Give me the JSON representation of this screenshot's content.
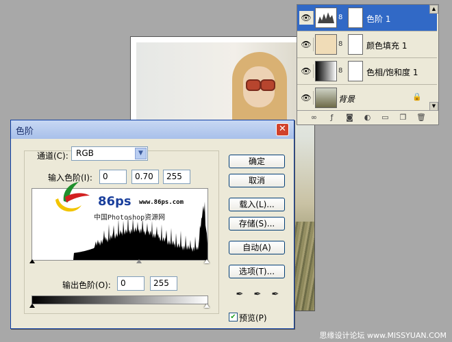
{
  "layers_panel": {
    "layers": [
      {
        "name": "色阶 1",
        "selected": true,
        "locked": false
      },
      {
        "name": "颜色填充 1",
        "selected": false,
        "locked": false
      },
      {
        "name": "色相/饱和度 1",
        "selected": false,
        "locked": false
      },
      {
        "name": "背景",
        "selected": false,
        "locked": true
      }
    ]
  },
  "levels_dialog": {
    "title": "色阶",
    "channel_label": "通道(C):",
    "channel_value": "RGB",
    "input_label": "输入色阶(I):",
    "input_levels": [
      "0",
      "0.70",
      "255"
    ],
    "output_label": "输出色阶(O):",
    "output_levels": [
      "0",
      "255"
    ],
    "buttons": {
      "ok": "确定",
      "cancel": "取消",
      "load": "载入(L)...",
      "save": "存储(S)...",
      "auto": "自动(A)",
      "options": "选项(T)..."
    },
    "preview_label": "预览(P)",
    "preview_checked": true
  },
  "watermark": {
    "number": "86ps",
    "url": "www.86ps.com",
    "chinese": "中国Photoshop资源网"
  },
  "footer": "思缘设计论坛  www.MISSYUAN.COM",
  "colors": {
    "selection": "#3169c6",
    "dialog_border": "#0c3da4",
    "close": "#d1412b"
  }
}
